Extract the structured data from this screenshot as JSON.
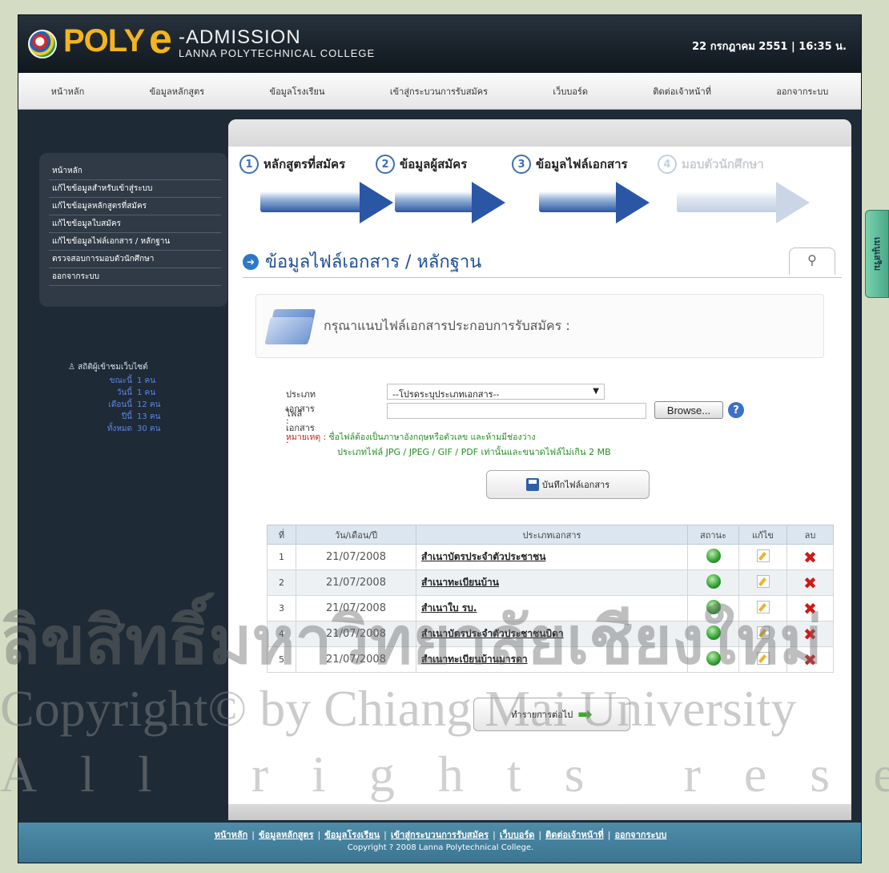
{
  "brand": {
    "poly": "POLY",
    "e": "e",
    "admission": "-ADMISSION",
    "college": "LANNA POLYTECHNICAL COLLEGE"
  },
  "header": {
    "datetime": "22 กรกฎาคม 2551  |  16:35 น."
  },
  "nav": [
    "หน้าหลัก",
    "ข้อมูลหลักสูตร",
    "ข้อมูลโรงเรียน",
    "เข้าสู่กระบวนการรับสมัคร",
    "เว็บบอร์ด",
    "ติดต่อเจ้าหน้าที่",
    "ออกจากระบบ"
  ],
  "sidebar": {
    "items": [
      "หน้าหลัก",
      "แก้ไขข้อมูลสำหรับเข้าสู่ระบบ",
      "แก้ไขข้อมูลหลักสูตรที่สมัคร",
      "แก้ไขข้อมูลใบสมัคร",
      "แก้ไขข้อมูลไฟล์เอกสาร / หลักฐาน",
      "ตรวจสอบการมอบตัวนักศึกษา",
      "ออกจากระบบ"
    ],
    "stats_title": "สถิติผู้เข้าชมเว็บไซต์",
    "stats": [
      {
        "label": "ขณะนี้",
        "value": "1 คน"
      },
      {
        "label": "วันนี้",
        "value": "1 คน"
      },
      {
        "label": "เดือนนี้",
        "value": "12 คน"
      },
      {
        "label": "ปีนี้",
        "value": "13 คน"
      },
      {
        "label": "ทั้งหมด",
        "value": "30 คน"
      }
    ]
  },
  "steps": [
    {
      "num": "1",
      "label": "หลักสูตรที่สมัคร",
      "active": true
    },
    {
      "num": "2",
      "label": "ข้อมูลผู้สมัคร",
      "active": true
    },
    {
      "num": "3",
      "label": "ข้อมูลไฟล์เอกสาร",
      "active": true
    },
    {
      "num": "4",
      "label": "มอบตัวนักศึกษา",
      "active": false
    }
  ],
  "page": {
    "heading": "ข้อมูลไฟล์เอกสาร / หลักฐาน",
    "notice": "กรุณาแนบไฟล์เอกสารประกอบการรับสมัคร :"
  },
  "form": {
    "doc_type_label": "ประเภทเอกสาร :",
    "doc_type_value": "--โปรดระบุประเภทเอกสาร--",
    "file_label": "ไฟล์เอกสาร :",
    "browse_label": "Browse...",
    "note_label": "หมายเหตุ :",
    "note_line1": " ชื่อไฟล์ต้องเป็นภาษาอังกฤษหรือตัวเลข และห้ามมีช่องว่าง",
    "note_line2": "ประเภทไฟล์ JPG / JPEG / GIF / PDF เท่านั้นและขนาดไฟล์ไม่เกิน 2 MB",
    "save_label": "บันทึกไฟล์เอกสาร"
  },
  "table": {
    "headers": [
      "ที่",
      "วัน/เดือน/ปี",
      "ประเภทเอกสาร",
      "สถานะ",
      "แก้ไข",
      "ลบ"
    ],
    "rows": [
      {
        "no": "1",
        "date": "21/07/2008",
        "doc": "สำเนาบัตรประจำตัวประชาชน"
      },
      {
        "no": "2",
        "date": "21/07/2008",
        "doc": "สำเนาทะเบียนบ้าน"
      },
      {
        "no": "3",
        "date": "21/07/2008",
        "doc": "สำเนาใบ รบ."
      },
      {
        "no": "4",
        "date": "21/07/2008",
        "doc": "สำเนาบัตรประจำตัวประชาชนบิดา"
      },
      {
        "no": "5",
        "date": "21/07/2008",
        "doc": "สำเนาทะเบียนบ้านมารดา"
      }
    ]
  },
  "next_label": "ทำรายการต่อไป",
  "footer": {
    "links": [
      "หน้าหลัก",
      "ข้อมูลหลักสูตร",
      "ข้อมูลโรงเรียน",
      "เข้าสู่กระบวนการรับสมัคร",
      "เว็บบอร์ด",
      "ติดต่อเจ้าหน้าที่",
      "ออกจากระบบ"
    ],
    "copyright": "Copyright ? 2008 Lanna Polytechnical College."
  },
  "side_tab": "เมนูเสริม",
  "watermark": {
    "line1": "ลิขสิทธิ์มหาวิทยาลัยเชียงใหม่",
    "line2": "Copyright© by Chiang Mai University",
    "line3": "All rights reserved"
  }
}
